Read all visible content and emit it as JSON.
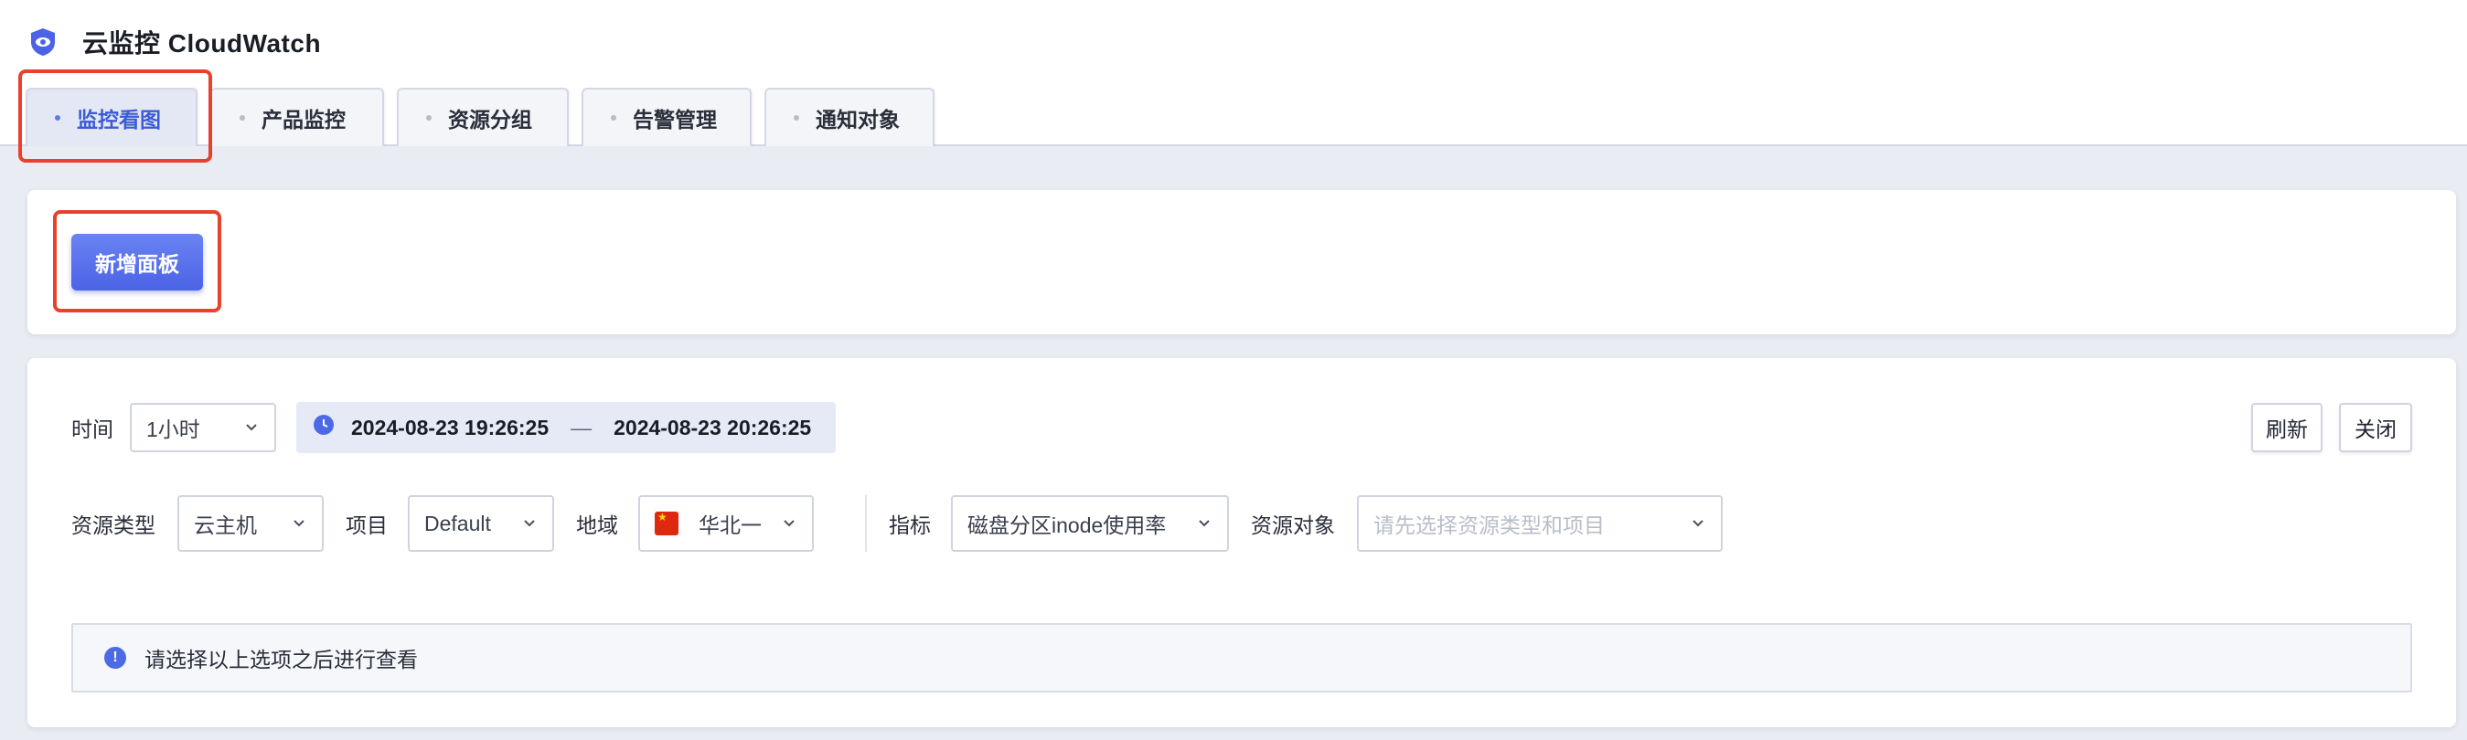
{
  "app": {
    "title": "云监控 CloudWatch",
    "icon": "cloudwatch-eye-shield-icon"
  },
  "tabs": [
    {
      "label": "监控看图",
      "active": true
    },
    {
      "label": "产品监控",
      "active": false
    },
    {
      "label": "资源分组",
      "active": false
    },
    {
      "label": "告警管理",
      "active": false
    },
    {
      "label": "通知对象",
      "active": false
    }
  ],
  "panel_actions": {
    "add_panel_label": "新增面板"
  },
  "filters": {
    "time_label": "时间",
    "time_range_select": "1小时",
    "range_start": "2024-08-23 19:26:25",
    "range_separator": "—",
    "range_end": "2024-08-23 20:26:25",
    "refresh_label": "刷新",
    "close_label": "关闭",
    "resource_type_label": "资源类型",
    "resource_type_value": "云主机",
    "project_label": "项目",
    "project_value": "Default",
    "region_label": "地域",
    "region_value": "华北一",
    "metric_label": "指标",
    "metric_value": "磁盘分区inode使用率",
    "resource_object_label": "资源对象",
    "resource_object_placeholder": "请先选择资源类型和项目"
  },
  "notice": {
    "text": "请选择以上选项之后进行查看",
    "icon": "info-icon"
  },
  "colors": {
    "accent": "#4b63e6",
    "highlight_box": "#e8412e",
    "region_flag": "#de2910"
  }
}
